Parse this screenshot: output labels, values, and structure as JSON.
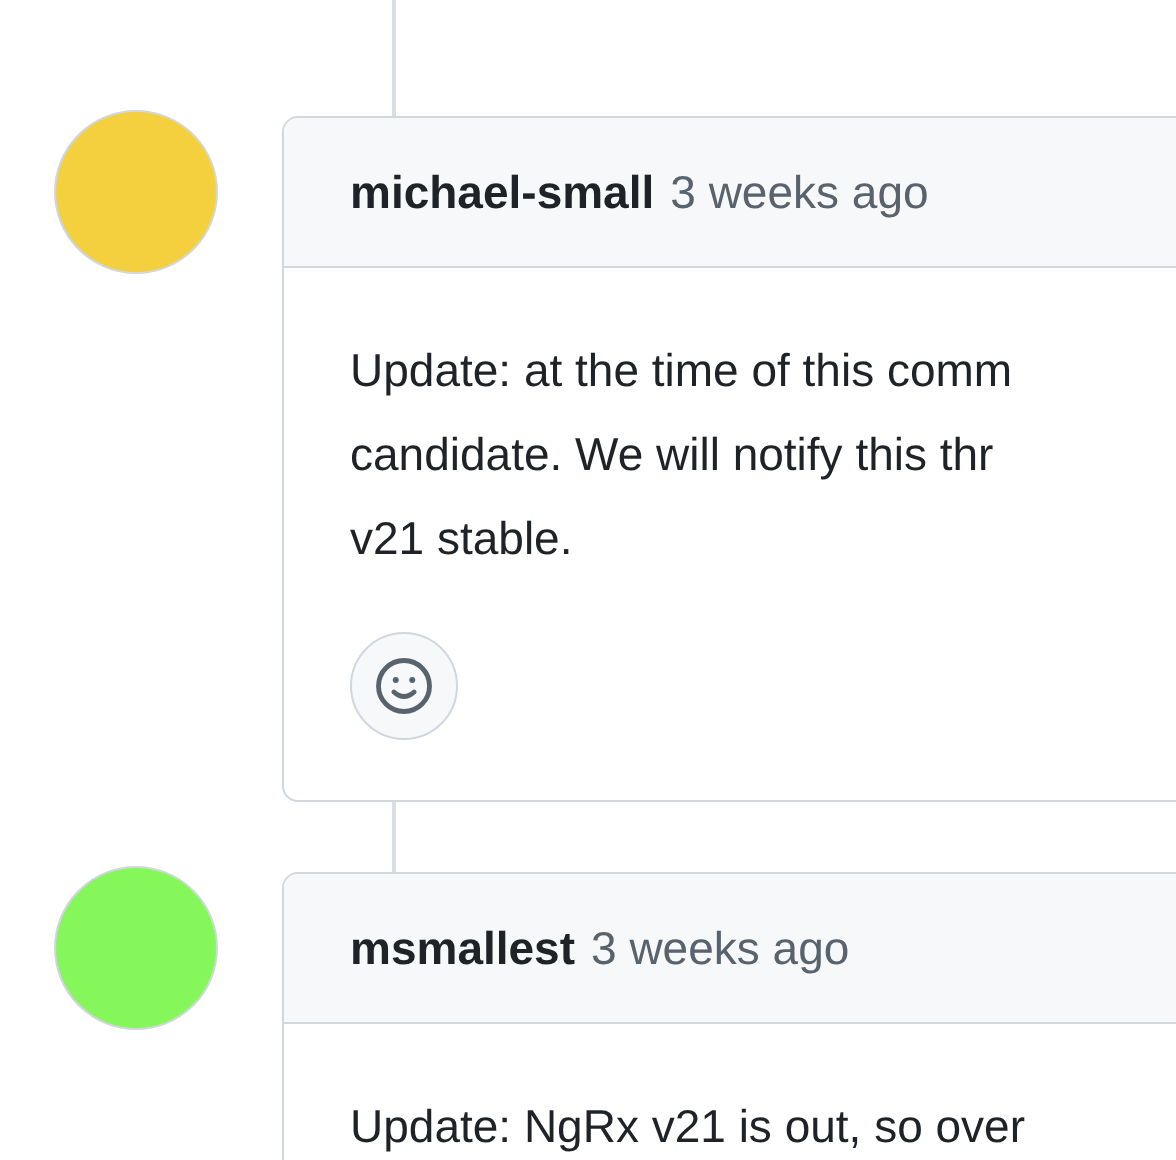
{
  "comments": [
    {
      "author": "michael-small",
      "time": "3 weeks ago",
      "avatar": {
        "color": "#f4d03f"
      },
      "body_lines": [
        "Update: at the time of this comm",
        "candidate. We will notify this thr",
        "v21 stable."
      ]
    },
    {
      "author": "msmallest",
      "time": "3 weeks ago",
      "avatar": {
        "color": "#86f75a"
      },
      "body_lines": [
        "Update: NgRx v21 is out, so over"
      ]
    }
  ]
}
